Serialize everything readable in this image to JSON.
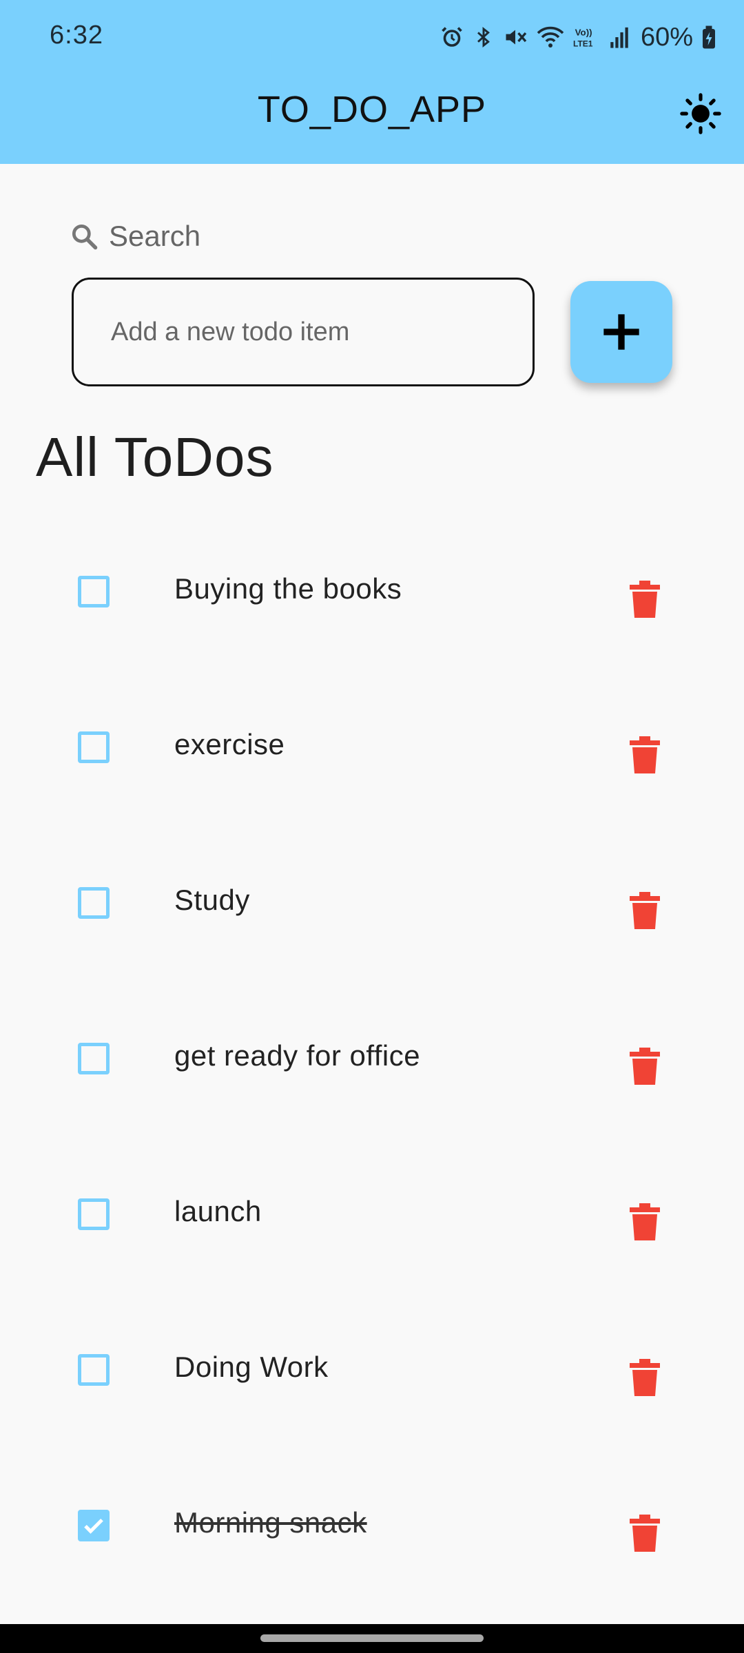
{
  "status_bar": {
    "time": "6:32",
    "battery": "60%",
    "icons": [
      "alarm-icon",
      "bluetooth-icon",
      "mute-icon",
      "wifi-icon",
      "volte-icon",
      "signal-icon",
      "battery-charging-icon"
    ]
  },
  "app_bar": {
    "title": "TO_DO_APP",
    "theme_toggle_icon": "sun-icon",
    "background": "#7ad0fd"
  },
  "search": {
    "placeholder": "Search",
    "icon": "search-icon"
  },
  "new_todo": {
    "placeholder": "Add a new todo item",
    "add_icon": "plus-icon"
  },
  "section_title": "All ToDos",
  "todos": [
    {
      "text": "Buying the books",
      "done": false
    },
    {
      "text": "exercise",
      "done": false
    },
    {
      "text": "Study",
      "done": false
    },
    {
      "text": "get ready for office",
      "done": false
    },
    {
      "text": "launch",
      "done": false
    },
    {
      "text": "Doing Work",
      "done": false
    },
    {
      "text": "Morning snack",
      "done": true
    }
  ],
  "colors": {
    "accent": "#7ad0fd",
    "delete": "#f04335",
    "background": "#f9f9f9"
  }
}
